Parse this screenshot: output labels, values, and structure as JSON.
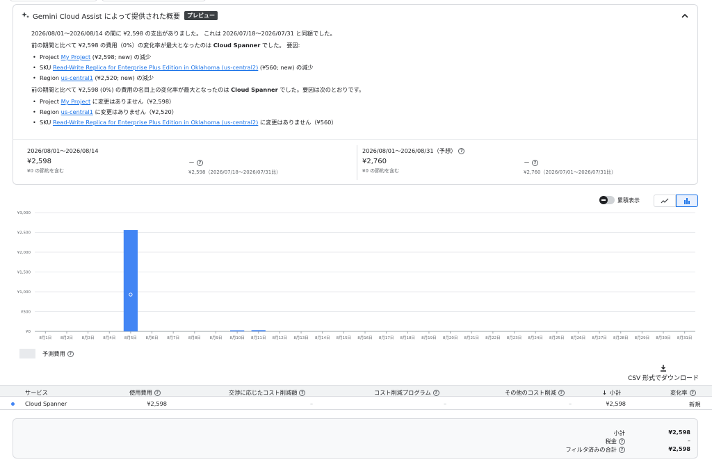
{
  "gemini": {
    "title": "Gemini Cloud Assist によって提供された概要",
    "badge": "プレビュー",
    "intro": "2026/08/01～2026/08/14 の間に ¥2,598 の支出がありました。 これは 2026/07/18～2026/07/31 と同額でした。",
    "p1_prefix": "前の期間と比べて ¥2,598 の費用（0%）の変化率が最大となったのは ",
    "p1_service": "Cloud Spanner",
    "p1_suffix": " でした。 要因:",
    "list1": [
      {
        "pre": "Project ",
        "link": "My Project",
        "post": " (¥2,598; new) の減少"
      },
      {
        "pre": "SKU ",
        "link": "Read-Write Replica for Enterprise Plus Edition in Oklahoma (us-central2)",
        "post": " (¥560; new) の減少"
      },
      {
        "pre": "Region ",
        "link": "us-central1",
        "post": " (¥2,520; new) の減少"
      }
    ],
    "p2_prefix": "前の期間と比べて ¥2,598 (0%) の費用の名目上の変化率が最大となったのは ",
    "p2_service": "Cloud Spanner",
    "p2_suffix": " でした。要因は次のとおりです。",
    "list2": [
      {
        "pre": "Project ",
        "link": "My Project",
        "post": " に変更はありません（¥2,598）"
      },
      {
        "pre": "Region ",
        "link": "us-central1",
        "post": " に変更はありません（¥2,520）"
      },
      {
        "pre": "SKU ",
        "link": "Read-Write Replica for Enterprise Plus Edition in Oklahoma (us-central2)",
        "post": " に変更はありません（¥560）"
      }
    ]
  },
  "summary": {
    "left": {
      "period": "2026/08/01～2026/08/14",
      "amount": "¥2,598",
      "note": "¥0 の節約を含む",
      "change": "－",
      "compare": "¥2,598（2026/07/18～2026/07/31比）"
    },
    "right": {
      "period": "2026/08/01～2026/08/31（予想）",
      "amount": "¥2,760",
      "note": "¥0 の節約を含む",
      "change": "－",
      "compare": "¥2,760（2026/07/01～2026/07/31比）"
    }
  },
  "controls": {
    "cumulative_label": "累積表示",
    "line_icon": "line-chart-icon",
    "bar_icon": "bar-chart-icon"
  },
  "chart_data": {
    "type": "bar",
    "categories": [
      "8月1日",
      "8月2日",
      "8月3日",
      "8月4日",
      "8月5日",
      "8月6日",
      "8月7日",
      "8月8日",
      "8月9日",
      "8月10日",
      "8月11日",
      "8月12日",
      "8月13日",
      "8月14日",
      "8月15日",
      "8月16日",
      "8月17日",
      "8月18日",
      "8月19日",
      "8月20日",
      "8月21日",
      "8月22日",
      "8月23日",
      "8月24日",
      "8月25日",
      "8月26日",
      "8月27日",
      "8月28日",
      "8月29日",
      "8月30日",
      "8月31日"
    ],
    "values": [
      0,
      0,
      0,
      0,
      2560,
      0,
      0,
      0,
      0,
      8,
      30,
      0,
      0,
      0,
      0,
      0,
      0,
      0,
      0,
      0,
      0,
      0,
      0,
      0,
      0,
      0,
      0,
      0,
      0,
      0,
      0
    ],
    "yticks": [
      "¥0",
      "¥500",
      "¥1,000",
      "¥1,500",
      "¥2,000",
      "¥2,500",
      "¥3,000"
    ],
    "ylim": [
      0,
      3000
    ],
    "color": "#4285f4",
    "grid": true
  },
  "legend": {
    "forecast": "予測費用"
  },
  "download": {
    "label": "CSV 形式でダウンロード"
  },
  "table": {
    "headers": {
      "service": "サービス",
      "usage": "使用費用",
      "negotiated": "交渉に応じたコスト削減額",
      "program": "コスト削減プログラム",
      "other": "その他のコスト削減",
      "subtotal": "小計",
      "change": "変化率"
    },
    "rows": [
      {
        "service": "Cloud Spanner",
        "usage": "¥2,598",
        "negotiated": "–",
        "program": "–",
        "other": "–",
        "subtotal": "¥2,598",
        "change": "新規"
      }
    ]
  },
  "totals": {
    "subtotal_label": "小計",
    "subtotal_value": "¥2,598",
    "tax_label": "税金",
    "tax_value": "–",
    "filtered_label": "フィルタ済みの合計",
    "filtered_value": "¥2,598"
  }
}
